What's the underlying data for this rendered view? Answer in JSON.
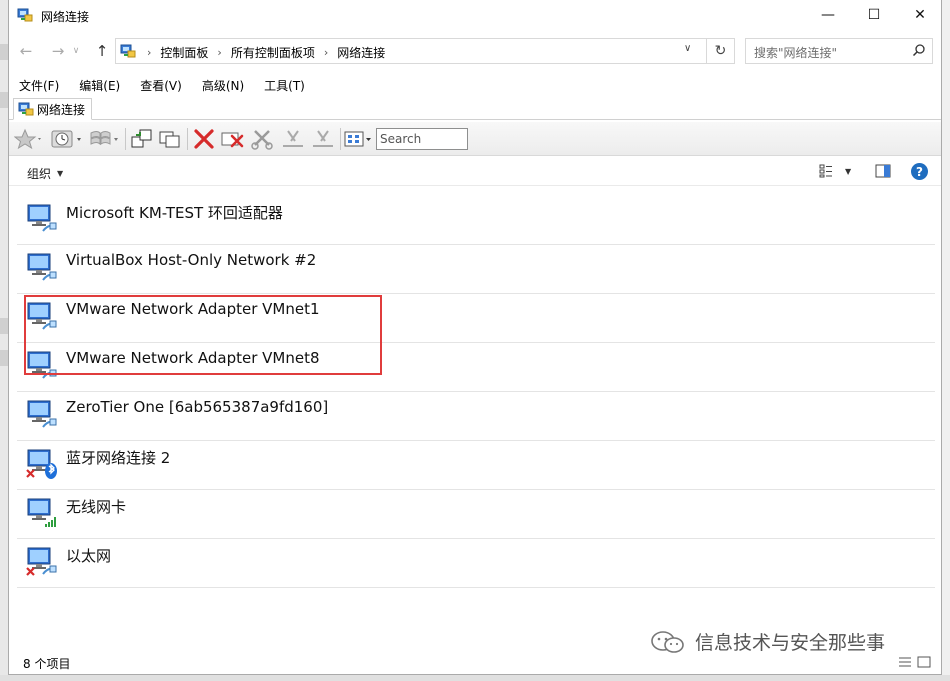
{
  "window": {
    "title": "网络连接",
    "controls": {
      "minimize": "—",
      "maximize": "☐",
      "close": "✕"
    }
  },
  "address": {
    "back_glyph": "←",
    "forward_glyph": "→",
    "recent_glyph": "∨",
    "up_glyph": "↑",
    "breadcrumbs": [
      "控制面板",
      "所有控制面板项",
      "网络连接"
    ],
    "dropdown_glyph": "∨",
    "refresh_glyph": "↻",
    "search_placeholder": "搜索\"网络连接\"",
    "search_icon": "search-icon"
  },
  "menu": [
    "文件(F)",
    "编辑(E)",
    "查看(V)",
    "高级(N)",
    "工具(T)"
  ],
  "tab": {
    "label": "网络连接"
  },
  "legacy_toolbar": {
    "search_placeholder": "Search",
    "icons": [
      "star-icon",
      "history-icon",
      "windows-flag-icon",
      "connect-icon",
      "copy-window-icon",
      "delete-red-x-icon",
      "disconnect-icon",
      "cut-icon",
      "cut-icon",
      "cut-icon",
      "view-grid-icon"
    ]
  },
  "commandbar": {
    "organize_label": "组织",
    "help_glyph": "?"
  },
  "connections": [
    {
      "name": "Microsoft KM-TEST 环回适配器",
      "status": "normal"
    },
    {
      "name": "VirtualBox Host-Only Network #2",
      "status": "normal"
    },
    {
      "name": "VMware Network Adapter VMnet1",
      "status": "normal"
    },
    {
      "name": "VMware Network Adapter VMnet8",
      "status": "normal"
    },
    {
      "name": "ZeroTier One [6ab565387a9fd160]",
      "status": "normal"
    },
    {
      "name": "蓝牙网络连接 2",
      "status": "disconnected-bluetooth"
    },
    {
      "name": "无线网卡",
      "status": "wireless"
    },
    {
      "name": "以太网",
      "status": "disconnected"
    }
  ],
  "status": {
    "item_count": "8 个项目",
    "watermark": "信息技术与安全那些事"
  },
  "colors": {
    "highlight_border": "#e03c3c",
    "help_blue": "#1f6dbf"
  }
}
